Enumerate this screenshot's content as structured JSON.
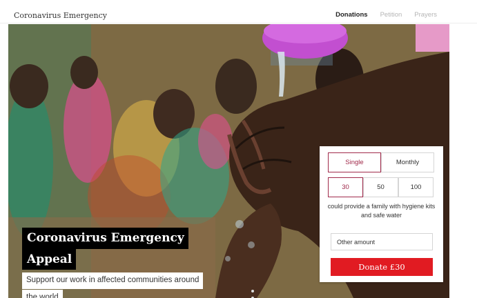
{
  "header": {
    "brand": "Coronavirus Emergency",
    "nav": [
      {
        "label": "Donations",
        "active": true
      },
      {
        "label": "Petition",
        "active": false
      },
      {
        "label": "Prayers",
        "active": false
      }
    ]
  },
  "hero": {
    "title_line1": "Coronavirus Emergency",
    "title_line2": "Appeal",
    "subtitle_line1": "Support our work in affected communities around",
    "subtitle_line2": "the world"
  },
  "donation": {
    "frequency": [
      {
        "label": "Single",
        "selected": true
      },
      {
        "label": "Monthly",
        "selected": false
      }
    ],
    "amounts": [
      {
        "label": "30",
        "selected": true
      },
      {
        "label": "50",
        "selected": false
      },
      {
        "label": "100",
        "selected": false
      }
    ],
    "description": "could provide a family with hygiene kits and safe water",
    "other_placeholder": "Other amount",
    "donate_label": "Donate £30"
  },
  "colors": {
    "accent": "#a0294a",
    "donate": "#e11b22"
  }
}
